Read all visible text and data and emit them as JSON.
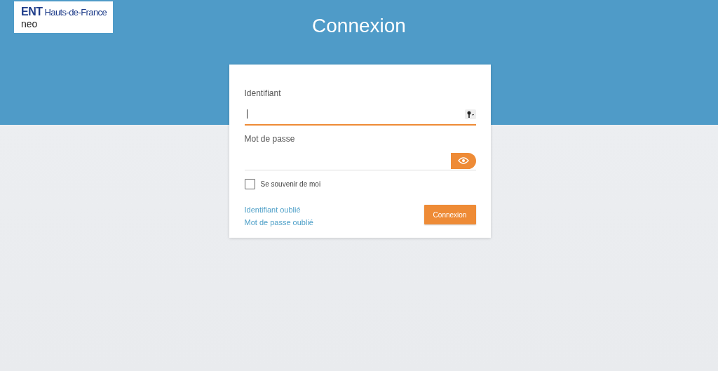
{
  "logo": {
    "brand": "ENT",
    "region": "Hauts-de-France",
    "product": "neo"
  },
  "title": "Connexion",
  "form": {
    "fields": [
      {
        "kind": "login",
        "label": "Identifiant",
        "focused": true
      },
      {
        "kind": "password",
        "label": "Mot de passe",
        "focused": false
      }
    ],
    "remember": {
      "label": "Se souvenir de moi",
      "checked": false
    },
    "links": [
      "Identifiant oublié",
      "Mot de passe oublié"
    ],
    "submit": "Connexion"
  }
}
